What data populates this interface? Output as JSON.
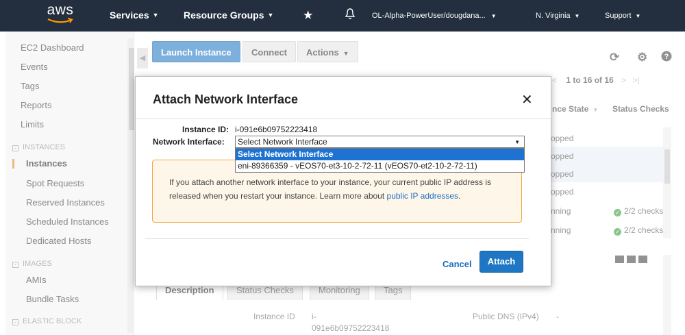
{
  "topnav": {
    "logo_text": "aws",
    "services": "Services",
    "resource_groups": "Resource Groups",
    "account": "OL-Alpha-PowerUser/dougdana...",
    "region": "N. Virginia",
    "support": "Support"
  },
  "sidebar": {
    "items": [
      {
        "label": "EC2 Dashboard"
      },
      {
        "label": "Events"
      },
      {
        "label": "Tags"
      },
      {
        "label": "Reports"
      },
      {
        "label": "Limits"
      }
    ],
    "sections": [
      {
        "label": "INSTANCES"
      },
      {
        "label": "IMAGES"
      },
      {
        "label": "ELASTIC BLOCK"
      }
    ],
    "instances_items": [
      {
        "label": "Instances"
      },
      {
        "label": "Spot Requests"
      },
      {
        "label": "Reserved Instances"
      },
      {
        "label": "Scheduled Instances"
      },
      {
        "label": "Dedicated Hosts"
      }
    ],
    "images_items": [
      {
        "label": "AMIs"
      },
      {
        "label": "Bundle Tasks"
      }
    ]
  },
  "toolbar": {
    "launch_label": "Launch Instance",
    "connect_label": "Connect",
    "actions_label": "Actions"
  },
  "table": {
    "pager": "1 to 16 of 16",
    "col_state": "nce State",
    "col_checks": "Status Checks",
    "rows": [
      {
        "state": "opped",
        "checks": ""
      },
      {
        "state": "opped",
        "checks": ""
      },
      {
        "state": "opped",
        "checks": ""
      },
      {
        "state": "opped",
        "checks": ""
      },
      {
        "state": "nning",
        "checks": "2/2 checks"
      },
      {
        "state": "nning",
        "checks": "2/2 checks"
      }
    ]
  },
  "details": {
    "tabs": [
      "Description",
      "Status Checks",
      "Monitoring",
      "Tags"
    ],
    "instance_id_label": "Instance ID",
    "instance_id_value_1": "i-",
    "instance_id_value_2": "091e6b09752223418",
    "public_dns_label": "Public DNS (IPv4)",
    "public_dns_value": "-"
  },
  "modal": {
    "title": "Attach Network Interface",
    "instance_id_label": "Instance ID:",
    "instance_id_value": "i-091e6b09752223418",
    "network_interface_label": "Network Interface:",
    "select_value": "Select Network Interface",
    "options": [
      "Select Network Interface",
      "eni-89366359 - vEOS70-et3-10-2-72-11 (vEOS70-et2-10-2-72-11)"
    ],
    "warning_text": "If you attach another network interface to your instance, your current public IP address is released when you restart your instance. Learn more about",
    "warning_link": "public IP addresses",
    "warning_end": ".",
    "cancel_label": "Cancel",
    "attach_label": "Attach"
  },
  "colors": {
    "nav_bg": "#232f3e",
    "primary_blue": "#1f77c3",
    "warning_border": "#f0a641",
    "dropdown_highlight": "#1e73d2"
  }
}
